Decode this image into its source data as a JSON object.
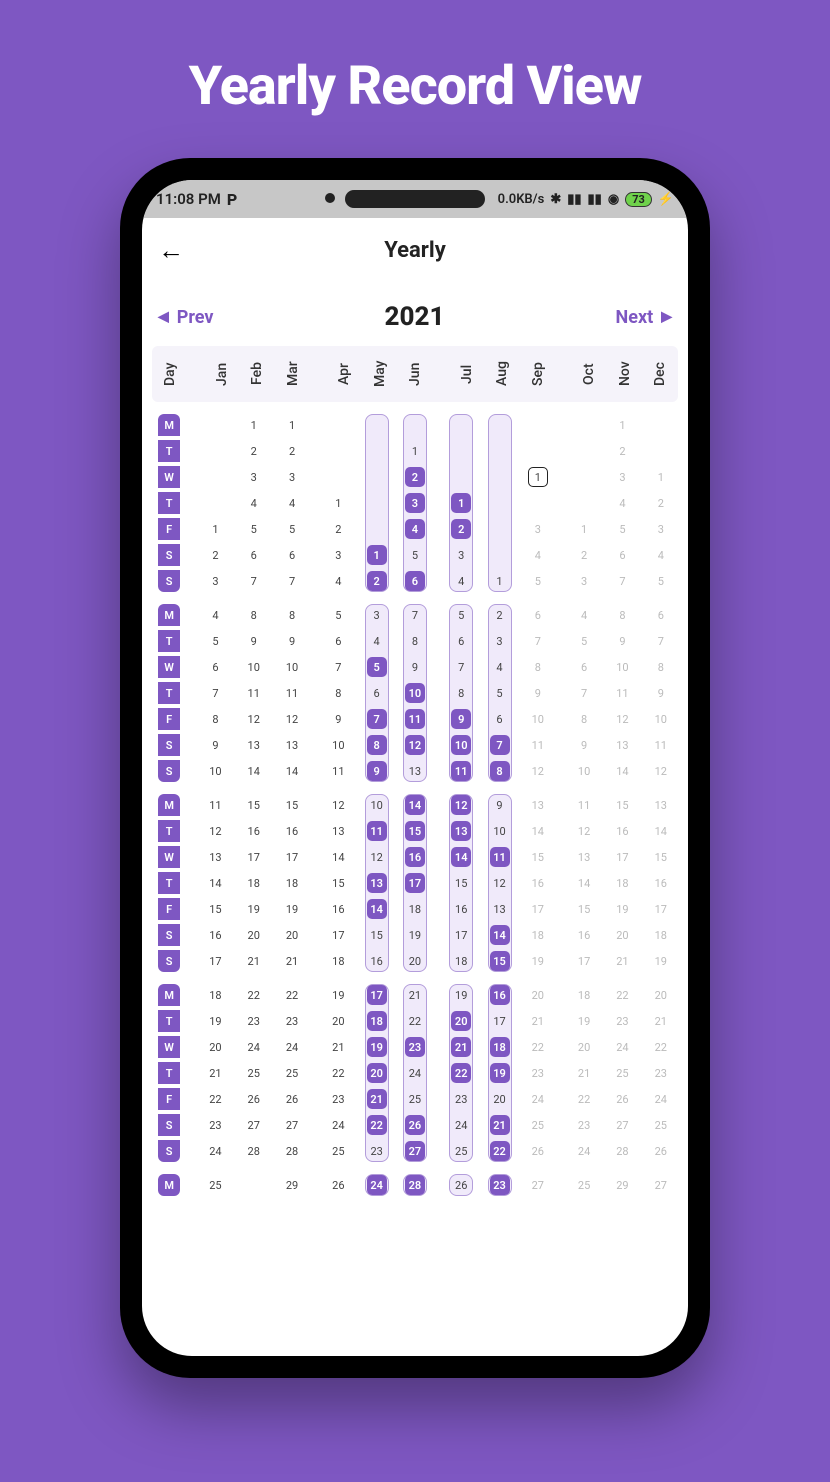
{
  "promo": {
    "title": "Yearly Record View"
  },
  "statusbar": {
    "time": "11:08 PM",
    "p": "P",
    "net": "0.0KB/s",
    "battery": "73"
  },
  "appbar": {
    "title": "Yearly"
  },
  "nav": {
    "prev": "Prev",
    "next": "Next",
    "year": "2021"
  },
  "months": [
    "Day",
    "Jan",
    "Feb",
    "Mar",
    "Apr",
    "May",
    "Jun",
    "Jul",
    "Aug",
    "Sep",
    "Oct",
    "Nov",
    "Dec"
  ],
  "daynames": [
    "M",
    "T",
    "W",
    "T",
    "F",
    "S",
    "S"
  ],
  "weeks": [
    {
      "strips": [
        {
          "col": 5,
          "from": 0,
          "to": 6
        },
        {
          "col": 6,
          "from": 0,
          "to": 6
        },
        {
          "col": 7,
          "from": 0,
          "to": 6
        },
        {
          "col": 8,
          "from": 0,
          "to": 6
        }
      ],
      "rows": [
        [
          "",
          "1",
          "1",
          "",
          "",
          "",
          "",
          "",
          "",
          "",
          "1",
          ""
        ],
        [
          "",
          "2",
          "2",
          "",
          "",
          "1",
          "",
          "",
          "",
          "",
          "2",
          ""
        ],
        [
          "",
          "3",
          "3",
          "",
          "",
          "2",
          "",
          "",
          "1",
          "",
          "3",
          "1"
        ],
        [
          "",
          "4",
          "4",
          "1",
          "",
          "3",
          "1",
          "",
          "",
          "",
          "4",
          "2"
        ],
        [
          "1",
          "5",
          "5",
          "2",
          "",
          "4",
          "2",
          "",
          "3",
          "1",
          "5",
          "3"
        ],
        [
          "2",
          "6",
          "6",
          "3",
          "1",
          "5",
          "3",
          "",
          "4",
          "2",
          "6",
          "4"
        ],
        [
          "3",
          "7",
          "7",
          "4",
          "2",
          "6",
          "4",
          "1",
          "5",
          "3",
          "7",
          "5"
        ]
      ],
      "filled": {
        "5": [
          5,
          6
        ],
        "6": [
          2,
          3,
          4,
          6
        ],
        "7": [
          3,
          4
        ],
        "8": []
      },
      "today": {
        "col": 9,
        "row": 2
      },
      "light": {
        "9": [
          4,
          5,
          6
        ],
        "10": [
          4,
          5,
          6
        ],
        "11": [
          0,
          1,
          2,
          3,
          4,
          5,
          6
        ],
        "12": [
          2,
          3,
          4,
          5,
          6
        ]
      }
    },
    {
      "strips": [
        {
          "col": 5,
          "from": 0,
          "to": 6
        },
        {
          "col": 6,
          "from": 0,
          "to": 6
        },
        {
          "col": 7,
          "from": 0,
          "to": 6
        },
        {
          "col": 8,
          "from": 0,
          "to": 6
        }
      ],
      "rows": [
        [
          "4",
          "8",
          "8",
          "5",
          "3",
          "7",
          "5",
          "2",
          "6",
          "4",
          "8",
          "6"
        ],
        [
          "5",
          "9",
          "9",
          "6",
          "4",
          "8",
          "6",
          "3",
          "7",
          "5",
          "9",
          "7"
        ],
        [
          "6",
          "10",
          "10",
          "7",
          "5",
          "9",
          "7",
          "4",
          "8",
          "6",
          "10",
          "8"
        ],
        [
          "7",
          "11",
          "11",
          "8",
          "6",
          "10",
          "8",
          "5",
          "9",
          "7",
          "11",
          "9"
        ],
        [
          "8",
          "12",
          "12",
          "9",
          "7",
          "11",
          "9",
          "6",
          "10",
          "8",
          "12",
          "10"
        ],
        [
          "9",
          "13",
          "13",
          "10",
          "8",
          "12",
          "10",
          "7",
          "11",
          "9",
          "13",
          "11"
        ],
        [
          "10",
          "14",
          "14",
          "11",
          "9",
          "13",
          "11",
          "8",
          "12",
          "10",
          "14",
          "12"
        ]
      ],
      "filled": {
        "5": [
          2,
          4,
          5,
          6
        ],
        "6": [
          3,
          4,
          5
        ],
        "7": [
          4,
          5,
          6
        ],
        "8": [
          5,
          6
        ]
      },
      "light": {
        "9": [
          0,
          1,
          2,
          3,
          4,
          5,
          6
        ],
        "10": [
          0,
          1,
          2,
          3,
          4,
          5,
          6
        ],
        "11": [
          0,
          1,
          2,
          3,
          4,
          5,
          6
        ],
        "12": [
          0,
          1,
          2,
          3,
          4,
          5,
          6
        ]
      }
    },
    {
      "strips": [
        {
          "col": 5,
          "from": 0,
          "to": 6
        },
        {
          "col": 6,
          "from": 0,
          "to": 6
        },
        {
          "col": 7,
          "from": 0,
          "to": 6
        },
        {
          "col": 8,
          "from": 0,
          "to": 6
        }
      ],
      "rows": [
        [
          "11",
          "15",
          "15",
          "12",
          "10",
          "14",
          "12",
          "9",
          "13",
          "11",
          "15",
          "13"
        ],
        [
          "12",
          "16",
          "16",
          "13",
          "11",
          "15",
          "13",
          "10",
          "14",
          "12",
          "16",
          "14"
        ],
        [
          "13",
          "17",
          "17",
          "14",
          "12",
          "16",
          "14",
          "11",
          "15",
          "13",
          "17",
          "15"
        ],
        [
          "14",
          "18",
          "18",
          "15",
          "13",
          "17",
          "15",
          "12",
          "16",
          "14",
          "18",
          "16"
        ],
        [
          "15",
          "19",
          "19",
          "16",
          "14",
          "18",
          "16",
          "13",
          "17",
          "15",
          "19",
          "17"
        ],
        [
          "16",
          "20",
          "20",
          "17",
          "15",
          "19",
          "17",
          "14",
          "18",
          "16",
          "20",
          "18"
        ],
        [
          "17",
          "21",
          "21",
          "18",
          "16",
          "20",
          "18",
          "15",
          "19",
          "17",
          "21",
          "19"
        ]
      ],
      "filled": {
        "5": [
          1,
          3,
          4
        ],
        "6": [
          0,
          1,
          2,
          3
        ],
        "7": [
          0,
          1,
          2
        ],
        "8": [
          2,
          5,
          6
        ]
      },
      "light": {
        "9": [
          0,
          1,
          2,
          3,
          4,
          5,
          6
        ],
        "10": [
          0,
          1,
          2,
          3,
          4,
          5,
          6
        ],
        "11": [
          0,
          1,
          2,
          3,
          4,
          5,
          6
        ],
        "12": [
          0,
          1,
          2,
          3,
          4,
          5,
          6
        ]
      }
    },
    {
      "strips": [
        {
          "col": 5,
          "from": 0,
          "to": 6
        },
        {
          "col": 6,
          "from": 0,
          "to": 6
        },
        {
          "col": 7,
          "from": 0,
          "to": 6
        },
        {
          "col": 8,
          "from": 0,
          "to": 6
        }
      ],
      "rows": [
        [
          "18",
          "22",
          "22",
          "19",
          "17",
          "21",
          "19",
          "16",
          "20",
          "18",
          "22",
          "20"
        ],
        [
          "19",
          "23",
          "23",
          "20",
          "18",
          "22",
          "20",
          "17",
          "21",
          "19",
          "23",
          "21"
        ],
        [
          "20",
          "24",
          "24",
          "21",
          "19",
          "23",
          "21",
          "18",
          "22",
          "20",
          "24",
          "22"
        ],
        [
          "21",
          "25",
          "25",
          "22",
          "20",
          "24",
          "22",
          "19",
          "23",
          "21",
          "25",
          "23"
        ],
        [
          "22",
          "26",
          "26",
          "23",
          "21",
          "25",
          "23",
          "20",
          "24",
          "22",
          "26",
          "24"
        ],
        [
          "23",
          "27",
          "27",
          "24",
          "22",
          "26",
          "24",
          "21",
          "25",
          "23",
          "27",
          "25"
        ],
        [
          "24",
          "28",
          "28",
          "25",
          "23",
          "27",
          "25",
          "22",
          "26",
          "24",
          "28",
          "26"
        ]
      ],
      "filled": {
        "5": [
          0,
          1,
          2,
          3,
          4,
          5
        ],
        "6": [
          2,
          5,
          6
        ],
        "7": [
          1,
          2,
          3
        ],
        "8": [
          0,
          2,
          3,
          5,
          6
        ]
      },
      "light": {
        "9": [
          0,
          1,
          2,
          3,
          4,
          5,
          6
        ],
        "10": [
          0,
          1,
          2,
          3,
          4,
          5,
          6
        ],
        "11": [
          0,
          1,
          2,
          3,
          4,
          5,
          6
        ],
        "12": [
          0,
          1,
          2,
          3,
          4,
          5,
          6
        ]
      }
    },
    {
      "strips": [
        {
          "col": 5,
          "from": 0,
          "to": 0
        },
        {
          "col": 6,
          "from": 0,
          "to": 0
        },
        {
          "col": 7,
          "from": 0,
          "to": 0
        },
        {
          "col": 8,
          "from": 0,
          "to": 0
        }
      ],
      "rows": [
        [
          "25",
          "",
          "29",
          "26",
          "24",
          "28",
          "26",
          "23",
          "27",
          "25",
          "29",
          "27"
        ]
      ],
      "filled": {
        "5": [
          0
        ],
        "6": [
          0
        ],
        "8": [
          0
        ]
      },
      "light": {
        "9": [
          0
        ],
        "10": [
          0
        ],
        "11": [
          0
        ],
        "12": [
          0
        ]
      }
    }
  ]
}
